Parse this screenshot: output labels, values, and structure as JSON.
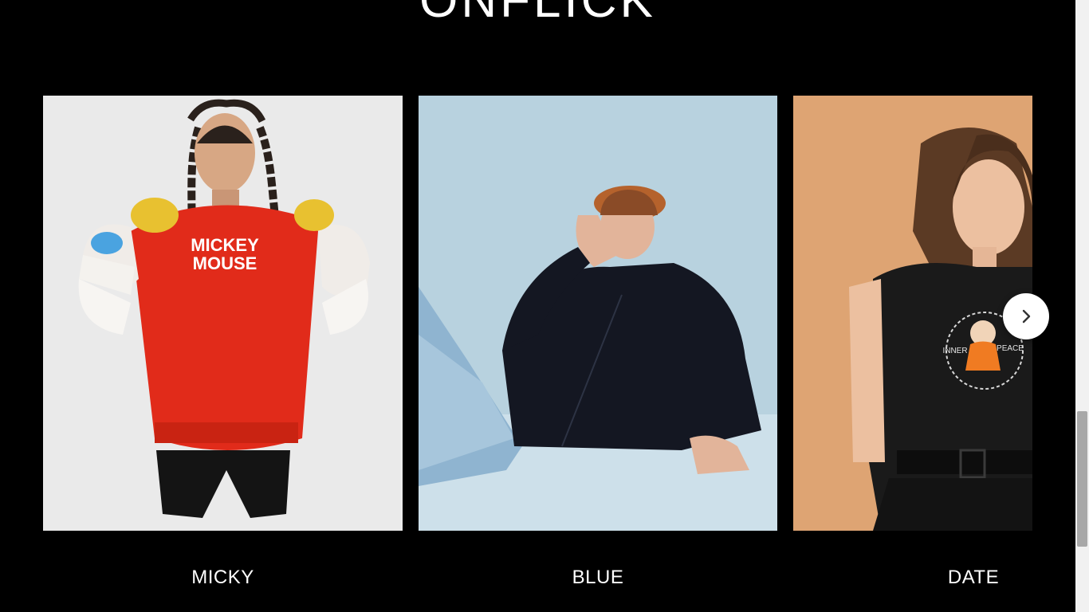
{
  "brand": {
    "name": "ONFLICK"
  },
  "products": [
    {
      "label": "MICKY",
      "image": "mickey-mouse-sweatshirt-photo"
    },
    {
      "label": "BLUE",
      "image": "man-black-zip-jacket-photo"
    },
    {
      "label": "DATE",
      "image": "woman-inner-peace-tshirt-photo"
    }
  ],
  "mickey_print": {
    "line1": "MICKEY",
    "line2": "MOUSE"
  },
  "tee_print": {
    "left": "INNER",
    "right": "PEACE"
  },
  "colors": {
    "background": "#000000",
    "text": "#ffffff",
    "sweatshirt": "#e12b1a",
    "jacket_backdrop": "#b9d3e0",
    "tee_backdrop": "#e0a574"
  },
  "icons": {
    "next": "chevron-right-icon"
  }
}
